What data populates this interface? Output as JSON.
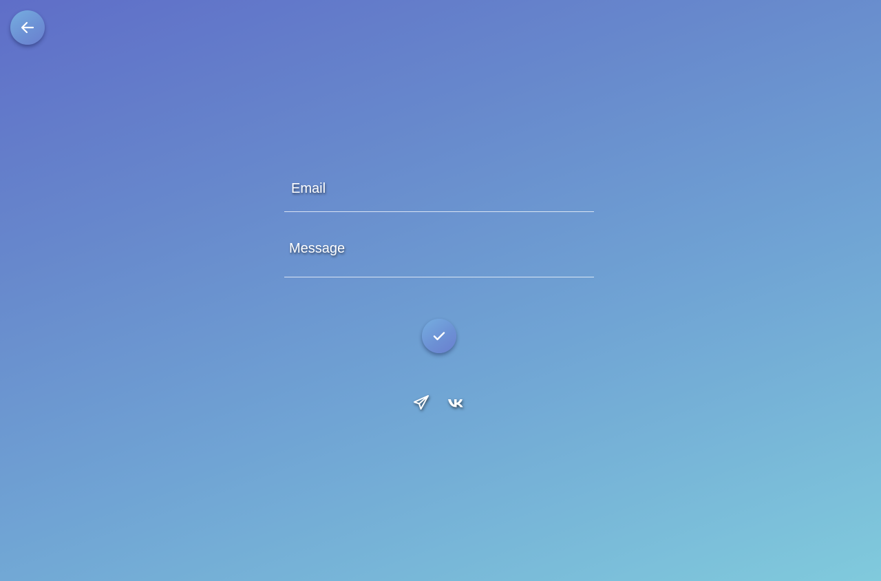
{
  "nav": {
    "back_icon": "arrow-left-icon"
  },
  "form": {
    "email": {
      "label": "Email",
      "value": ""
    },
    "message": {
      "label": "Message",
      "value": ""
    },
    "submit_icon": "check-icon"
  },
  "social": {
    "items": [
      {
        "icon": "telegram-icon"
      },
      {
        "icon": "vk-icon"
      }
    ]
  },
  "colors": {
    "background_start": "#5f6ec8",
    "background_end": "#80cadc",
    "button": "#6c8fd4",
    "text": "#ffffff"
  }
}
